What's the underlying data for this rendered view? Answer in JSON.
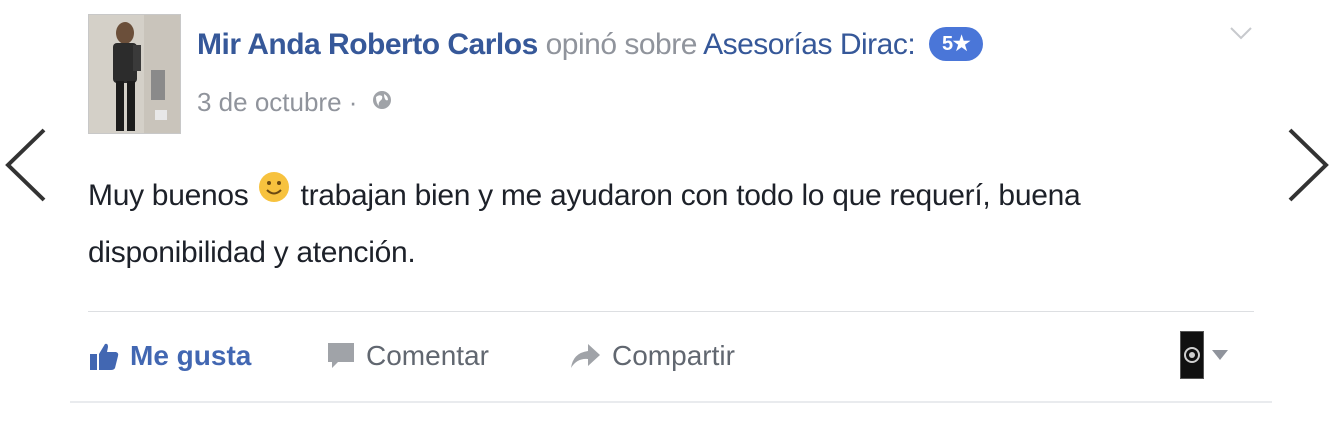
{
  "post": {
    "author": "Mir Anda Roberto Carlos",
    "verb": "opinó sobre",
    "page": "Asesorías Dirac:",
    "rating": "5★",
    "date": "3 de octubre",
    "date_separator": "·",
    "privacy_icon": "globe-icon",
    "text_part1": "Muy buenos",
    "emoji": "smiling-face-icon",
    "text_part2": "trabajan bien y me ayudaron con todo lo que requerí, buena disponibilidad y atención."
  },
  "actions": {
    "like": "Me gusta",
    "comment": "Comentar",
    "share": "Compartir"
  },
  "colors": {
    "link": "#365899",
    "like_blue": "#4267b2",
    "badge": "#4a76d8",
    "muted": "#90949c"
  }
}
